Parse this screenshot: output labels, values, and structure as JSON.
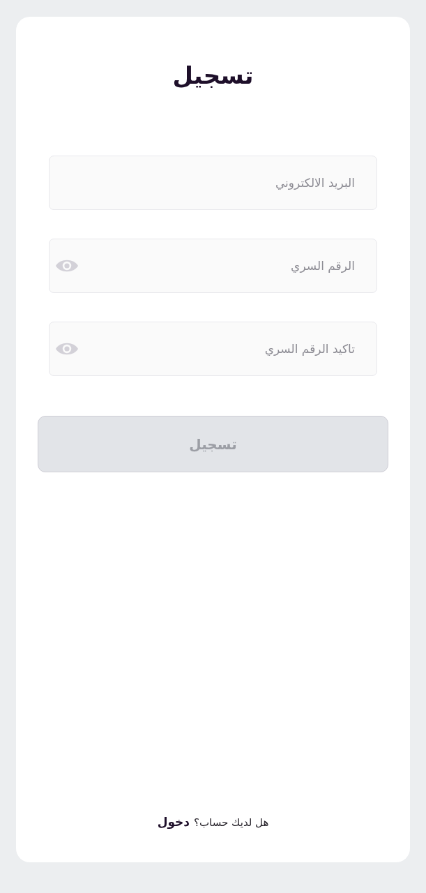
{
  "title": "تسجيل",
  "fields": [
    {
      "kind": "email",
      "placeholder": "البريد الالكتروني"
    },
    {
      "kind": "password",
      "placeholder": "الرقم السري"
    },
    {
      "kind": "password",
      "placeholder": "تاكيد الرقم السري"
    }
  ],
  "submit": {
    "label": "تسجيل",
    "disabled": true
  },
  "footer": {
    "prompt": "هل لديك حساب؟",
    "link": "دخول"
  }
}
